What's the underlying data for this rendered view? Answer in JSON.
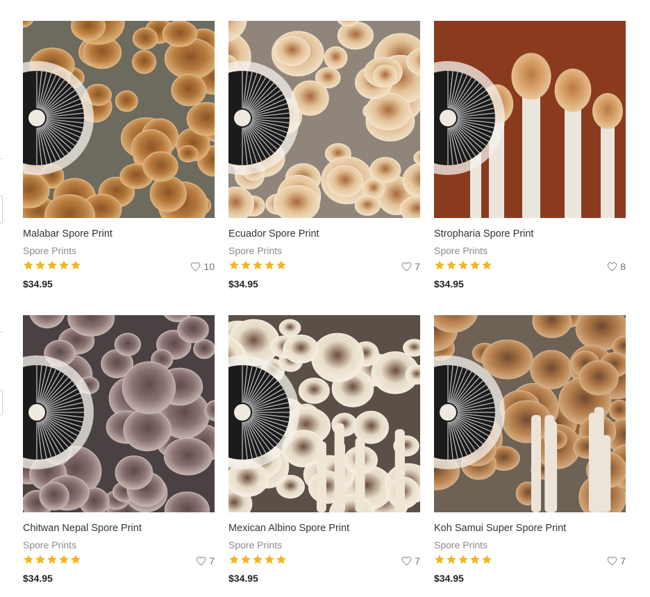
{
  "products": [
    {
      "title": "Malabar Spore Print",
      "category": "Spore Prints",
      "rating": 5,
      "likes": "10",
      "price": "$34.95",
      "image": {
        "bg": "#6d6a5e",
        "cap": "#b87b3c",
        "capDark": "#8a5426",
        "rim": "#e0b57e",
        "stem": "#d9cdb5"
      }
    },
    {
      "title": "Ecuador Spore Print",
      "category": "Spore Prints",
      "rating": 5,
      "likes": "7",
      "price": "$34.95",
      "image": {
        "bg": "#8f857a",
        "cap": "#e6c59a",
        "capDark": "#a8683a",
        "rim": "#f3e2c8",
        "stem": "#e6dccd"
      }
    },
    {
      "title": "Stropharia Spore Print",
      "category": "Spore Prints",
      "rating": 5,
      "likes": "8",
      "price": "$34.95",
      "image": {
        "bg": "#8a3b1e",
        "cap": "#d9a36a",
        "capDark": "#b97a45",
        "rim": "#e8c89e",
        "stem": "#ebe6dc"
      }
    },
    {
      "title": "Chitwan Nepal Spore Print",
      "category": "Spore Prints",
      "rating": 5,
      "likes": "7",
      "price": "$34.95",
      "image": {
        "bg": "#4a4142",
        "cap": "#8a7270",
        "capDark": "#5e4a4b",
        "rim": "#c7b6b2",
        "stem": "#bfb3ad"
      }
    },
    {
      "title": "Mexican Albino Spore Print",
      "category": "Spore Prints",
      "rating": 5,
      "likes": "7",
      "price": "$34.95",
      "image": {
        "bg": "#5a5048",
        "cap": "#eadfca",
        "capDark": "#6b4b3a",
        "rim": "#f6efe2",
        "stem": "#efe6d6"
      }
    },
    {
      "title": "Koh Samui Super Spore Print",
      "category": "Spore Prints",
      "rating": 5,
      "likes": "7",
      "price": "$34.95",
      "image": {
        "bg": "#6e6156",
        "cap": "#b57d4a",
        "capDark": "#6e4a30",
        "rim": "#d8b085",
        "stem": "#ece4d8"
      }
    }
  ],
  "colors": {
    "star": "#f5b51e",
    "title": "#333333",
    "category": "#8a8a8a",
    "price": "#222222"
  }
}
